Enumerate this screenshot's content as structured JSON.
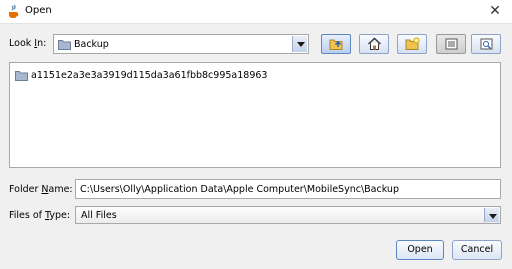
{
  "window": {
    "title": "Open",
    "close_glyph": "✕"
  },
  "look_in": {
    "label_pre": "Look ",
    "label_mnemonic": "I",
    "label_post": "n:",
    "value": "Backup",
    "toolbar_icons": [
      "up-one-level-icon",
      "home-icon",
      "create-new-folder-icon",
      "list-view-icon",
      "details-view-icon"
    ]
  },
  "file_list": {
    "items": [
      {
        "name": "a1151e2a3e3a3919d115da3a61fbb8c995a18963",
        "icon": "folder-icon"
      }
    ]
  },
  "folder_name": {
    "label_pre": "Folder ",
    "label_mnemonic": "N",
    "label_post": "ame:",
    "value": "C:\\Users\\Olly\\Application Data\\Apple Computer\\MobileSync\\Backup"
  },
  "files_of_type": {
    "label_pre": "Files of ",
    "label_mnemonic": "T",
    "label_post": "ype:",
    "value": "All Files"
  },
  "buttons": {
    "open": "Open",
    "cancel": "Cancel"
  },
  "colors": {
    "folder": "#8a9bb6",
    "accent_border": "#5e86c1"
  }
}
